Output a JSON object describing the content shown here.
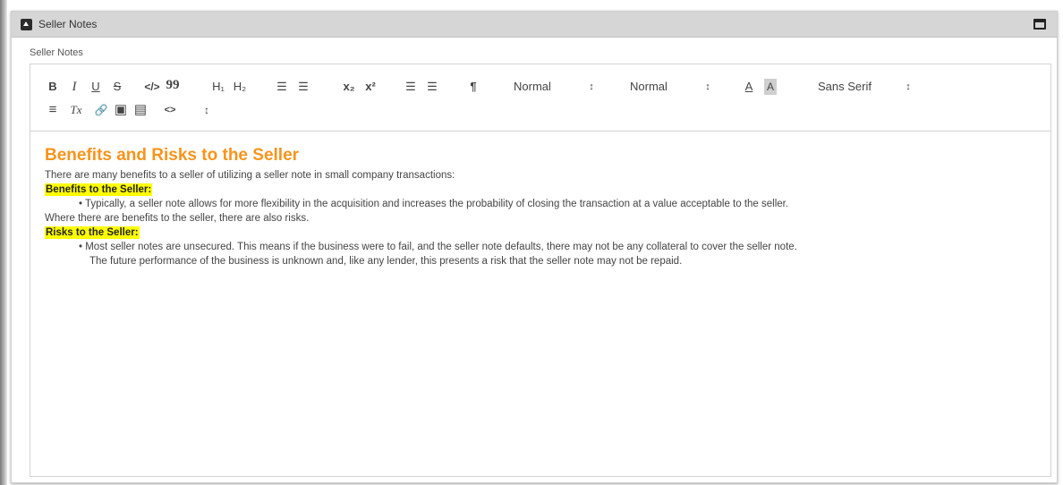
{
  "panel": {
    "title": "Seller Notes"
  },
  "field": {
    "label": "Seller Notes"
  },
  "toolbar": {
    "bold": "B",
    "italic": "I",
    "underline": "U",
    "strike": "S",
    "code": "</>",
    "quote": "99",
    "h1": "H₁",
    "h2": "H₂",
    "ordered_list": "☰",
    "bullet_list": "☰",
    "subscript": "x₂",
    "superscript": "x²",
    "indent_decrease": "☰",
    "indent_increase": "☰",
    "direction": "¶",
    "header_select": "Normal",
    "size_select": "Normal",
    "font_color": "A",
    "background_color": "A",
    "font_select": "Sans Serif",
    "align": "≡",
    "clean": "Tx",
    "link": "🔗",
    "image": "▣",
    "video": "▤",
    "code_block": "<>",
    "extra": "↕"
  },
  "content": {
    "heading": "Benefits and Risks to the Seller",
    "intro": "There are many benefits to a seller of utilizing a seller note in small company transactions:",
    "benefits_label": "Benefits to the Seller:",
    "benefit_1": "• Typically, a seller note allows for more flexibility in the acquisition and increases the probability of closing the transaction at a value acceptable to the seller.",
    "transition": "Where there are benefits to the seller, there are also risks.",
    "risks_label": "Risks to the Seller:",
    "risk_1_line1": "• Most seller notes are unsecured. This means if the business were to fail, and the seller note defaults, there may not be any collateral to cover the seller note.",
    "risk_1_line2": "The future performance of the business is unknown and, like any lender, this presents a risk that the seller note may not be repaid."
  },
  "colors": {
    "heading": "#f7941d",
    "highlight": "#ffff00",
    "header_bar": "#d6d6d6"
  }
}
